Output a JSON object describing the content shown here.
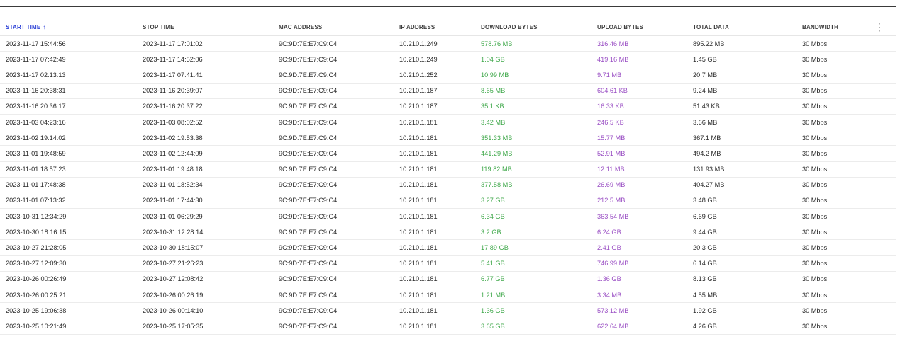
{
  "table": {
    "columns": [
      "START TIME",
      "STOP TIME",
      "MAC ADDRESS",
      "IP ADDRESS",
      "DOWNLOAD BYTES",
      "UPLOAD BYTES",
      "TOTAL DATA",
      "BANDWIDTH"
    ],
    "sort_arrow": "↑",
    "more_icon": "⋮",
    "rows": [
      [
        "2023-11-17 15:44:56",
        "2023-11-17 17:01:02",
        "9C:9D:7E:E7:C9:C4",
        "10.210.1.249",
        "578.76 MB",
        "316.46 MB",
        "895.22 MB",
        "30 Mbps"
      ],
      [
        "2023-11-17 07:42:49",
        "2023-11-17 14:52:06",
        "9C:9D:7E:E7:C9:C4",
        "10.210.1.249",
        "1.04 GB",
        "419.16 MB",
        "1.45 GB",
        "30 Mbps"
      ],
      [
        "2023-11-17 02:13:13",
        "2023-11-17 07:41:41",
        "9C:9D:7E:E7:C9:C4",
        "10.210.1.252",
        "10.99 MB",
        "9.71 MB",
        "20.7 MB",
        "30 Mbps"
      ],
      [
        "2023-11-16 20:38:31",
        "2023-11-16 20:39:07",
        "9C:9D:7E:E7:C9:C4",
        "10.210.1.187",
        "8.65 MB",
        "604.61 KB",
        "9.24 MB",
        "30 Mbps"
      ],
      [
        "2023-11-16 20:36:17",
        "2023-11-16 20:37:22",
        "9C:9D:7E:E7:C9:C4",
        "10.210.1.187",
        "35.1 KB",
        "16.33 KB",
        "51.43 KB",
        "30 Mbps"
      ],
      [
        "2023-11-03 04:23:16",
        "2023-11-03 08:02:52",
        "9C:9D:7E:E7:C9:C4",
        "10.210.1.181",
        "3.42 MB",
        "246.5 KB",
        "3.66 MB",
        "30 Mbps"
      ],
      [
        "2023-11-02 19:14:02",
        "2023-11-02 19:53:38",
        "9C:9D:7E:E7:C9:C4",
        "10.210.1.181",
        "351.33 MB",
        "15.77 MB",
        "367.1 MB",
        "30 Mbps"
      ],
      [
        "2023-11-01 19:48:59",
        "2023-11-02 12:44:09",
        "9C:9D:7E:E7:C9:C4",
        "10.210.1.181",
        "441.29 MB",
        "52.91 MB",
        "494.2 MB",
        "30 Mbps"
      ],
      [
        "2023-11-01 18:57:23",
        "2023-11-01 19:48:18",
        "9C:9D:7E:E7:C9:C4",
        "10.210.1.181",
        "119.82 MB",
        "12.11 MB",
        "131.93 MB",
        "30 Mbps"
      ],
      [
        "2023-11-01 17:48:38",
        "2023-11-01 18:52:34",
        "9C:9D:7E:E7:C9:C4",
        "10.210.1.181",
        "377.58 MB",
        "26.69 MB",
        "404.27 MB",
        "30 Mbps"
      ],
      [
        "2023-11-01 07:13:32",
        "2023-11-01 17:44:30",
        "9C:9D:7E:E7:C9:C4",
        "10.210.1.181",
        "3.27 GB",
        "212.5 MB",
        "3.48 GB",
        "30 Mbps"
      ],
      [
        "2023-10-31 12:34:29",
        "2023-11-01 06:29:29",
        "9C:9D:7E:E7:C9:C4",
        "10.210.1.181",
        "6.34 GB",
        "363.54 MB",
        "6.69 GB",
        "30 Mbps"
      ],
      [
        "2023-10-30 18:16:15",
        "2023-10-31 12:28:14",
        "9C:9D:7E:E7:C9:C4",
        "10.210.1.181",
        "3.2 GB",
        "6.24 GB",
        "9.44 GB",
        "30 Mbps"
      ],
      [
        "2023-10-27 21:28:05",
        "2023-10-30 18:15:07",
        "9C:9D:7E:E7:C9:C4",
        "10.210.1.181",
        "17.89 GB",
        "2.41 GB",
        "20.3 GB",
        "30 Mbps"
      ],
      [
        "2023-10-27 12:09:30",
        "2023-10-27 21:26:23",
        "9C:9D:7E:E7:C9:C4",
        "10.210.1.181",
        "5.41 GB",
        "746.99 MB",
        "6.14 GB",
        "30 Mbps"
      ],
      [
        "2023-10-26 00:26:49",
        "2023-10-27 12:08:42",
        "9C:9D:7E:E7:C9:C4",
        "10.210.1.181",
        "6.77 GB",
        "1.36 GB",
        "8.13 GB",
        "30 Mbps"
      ],
      [
        "2023-10-26 00:25:21",
        "2023-10-26 00:26:19",
        "9C:9D:7E:E7:C9:C4",
        "10.210.1.181",
        "1.21 MB",
        "3.34 MB",
        "4.55 MB",
        "30 Mbps"
      ],
      [
        "2023-10-25 19:06:38",
        "2023-10-26 00:14:10",
        "9C:9D:7E:E7:C9:C4",
        "10.210.1.181",
        "1.36 GB",
        "573.12 MB",
        "1.92 GB",
        "30 Mbps"
      ],
      [
        "2023-10-25 10:21:49",
        "2023-10-25 17:05:35",
        "9C:9D:7E:E7:C9:C4",
        "10.210.1.181",
        "3.65 GB",
        "622.64 MB",
        "4.26 GB",
        "30 Mbps"
      ]
    ]
  },
  "colors": {
    "sort_active": "#2a3fd6",
    "download": "#3fa84a",
    "upload": "#9a4fc4"
  }
}
